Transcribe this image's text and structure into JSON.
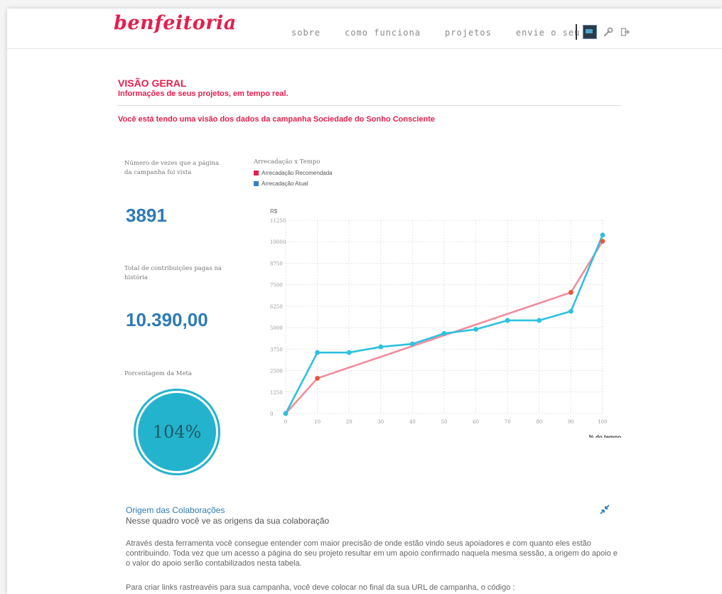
{
  "brand": {
    "logo": "benfeitoria"
  },
  "nav": {
    "items": [
      "sobre",
      "como funciona",
      "projetos",
      "envie o seu"
    ]
  },
  "tools": {
    "icons": [
      "user-thumbnail-icon",
      "wrench-icon",
      "logout-icon"
    ]
  },
  "header": {
    "title": "VISÃO GERAL",
    "subtitle": "Informações de seus projetos, em tempo real."
  },
  "campaign_notice": "Você está tendo uma visão dos dados da campanha Sociedade do Sonho Consciente",
  "stats": {
    "views_label": "Número de vezes que a página da campanha foi vista",
    "views_value": "3891",
    "total_label": "Total de contribuições pagas na história",
    "total_value": "10.390,00",
    "goal_label": "Porcentagem da Meta",
    "goal_value": "104%",
    "goal_fraction": 1.04
  },
  "colors": {
    "accent": "#e3204f",
    "blue": "#2e7bb5",
    "recommended": "#f28c9d",
    "actual": "#2ec1e0"
  },
  "chart_data": {
    "type": "line",
    "title": "Arrecadação x Tempo",
    "xlabel": "% do tempo",
    "ylabel": "R$",
    "x": [
      0,
      10,
      20,
      30,
      40,
      50,
      60,
      70,
      80,
      90,
      100
    ],
    "x_ticks": [
      "0",
      "10",
      "20",
      "30",
      "40",
      "50",
      "60",
      "70",
      "80",
      "90",
      "100"
    ],
    "y_ticks": [
      "0",
      "1250",
      "2500",
      "3750",
      "5000",
      "6250",
      "7500",
      "8750",
      "10000",
      "11250"
    ],
    "ylim": [
      0,
      11250
    ],
    "xlim": [
      0,
      100
    ],
    "grid": true,
    "legend_position": "top-left",
    "series": [
      {
        "name": "Arrecadação Recomendada",
        "color": "#f28c9d",
        "legend_color": "#e3204f",
        "marker_color": "#e8553d",
        "points": [
          [
            0,
            0
          ],
          [
            10,
            2050
          ],
          [
            90,
            7050
          ],
          [
            100,
            10030
          ]
        ]
      },
      {
        "name": "Arrecadação Atual",
        "color": "#2ec1e0",
        "legend_color": "#3a7fc0",
        "marker_color": "#2ec1e0",
        "points": [
          [
            0,
            0
          ],
          [
            10,
            3550
          ],
          [
            20,
            3550
          ],
          [
            30,
            3880
          ],
          [
            40,
            4050
          ],
          [
            50,
            4660
          ],
          [
            60,
            4900
          ],
          [
            70,
            5420
          ],
          [
            80,
            5420
          ],
          [
            90,
            5950
          ],
          [
            100,
            10390
          ]
        ]
      }
    ]
  },
  "origin": {
    "title": "Origem das Colaborações",
    "subtitle": "Nesse quadro você ve as origens da sua colaboração",
    "paragraph1": "Através desta ferramenta você consegue entender com maior precisão de onde estão vindo seus apoiadores e com quanto eles estão contribuindo. Toda vez que um acesso a página do seu projeto resultar em um apoio confirmado naquela mesma sessão, a origem do apoio e o valor do apoio serão contabilizados nesta tabela.",
    "paragraph2": "Para criar links rastreavéis para sua campanha, você deve colocar no final da sua URL de campanha, o código :"
  }
}
